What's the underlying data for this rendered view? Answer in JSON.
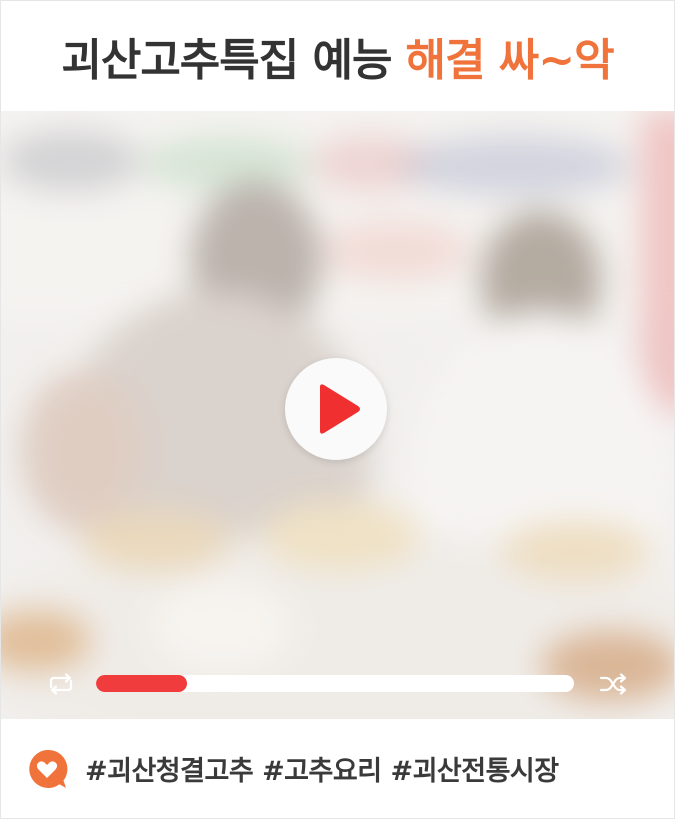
{
  "title": {
    "main": "괴산고추특집 예능",
    "accent": "해결 싸~악"
  },
  "player": {
    "progress_percent": 19
  },
  "footer": {
    "hashtags": "#괴산청결고추 #고추요리 #괴산전통시장"
  },
  "colors": {
    "accent": "#f0733c",
    "play": "#f03030",
    "progress": "#f03c3c"
  }
}
